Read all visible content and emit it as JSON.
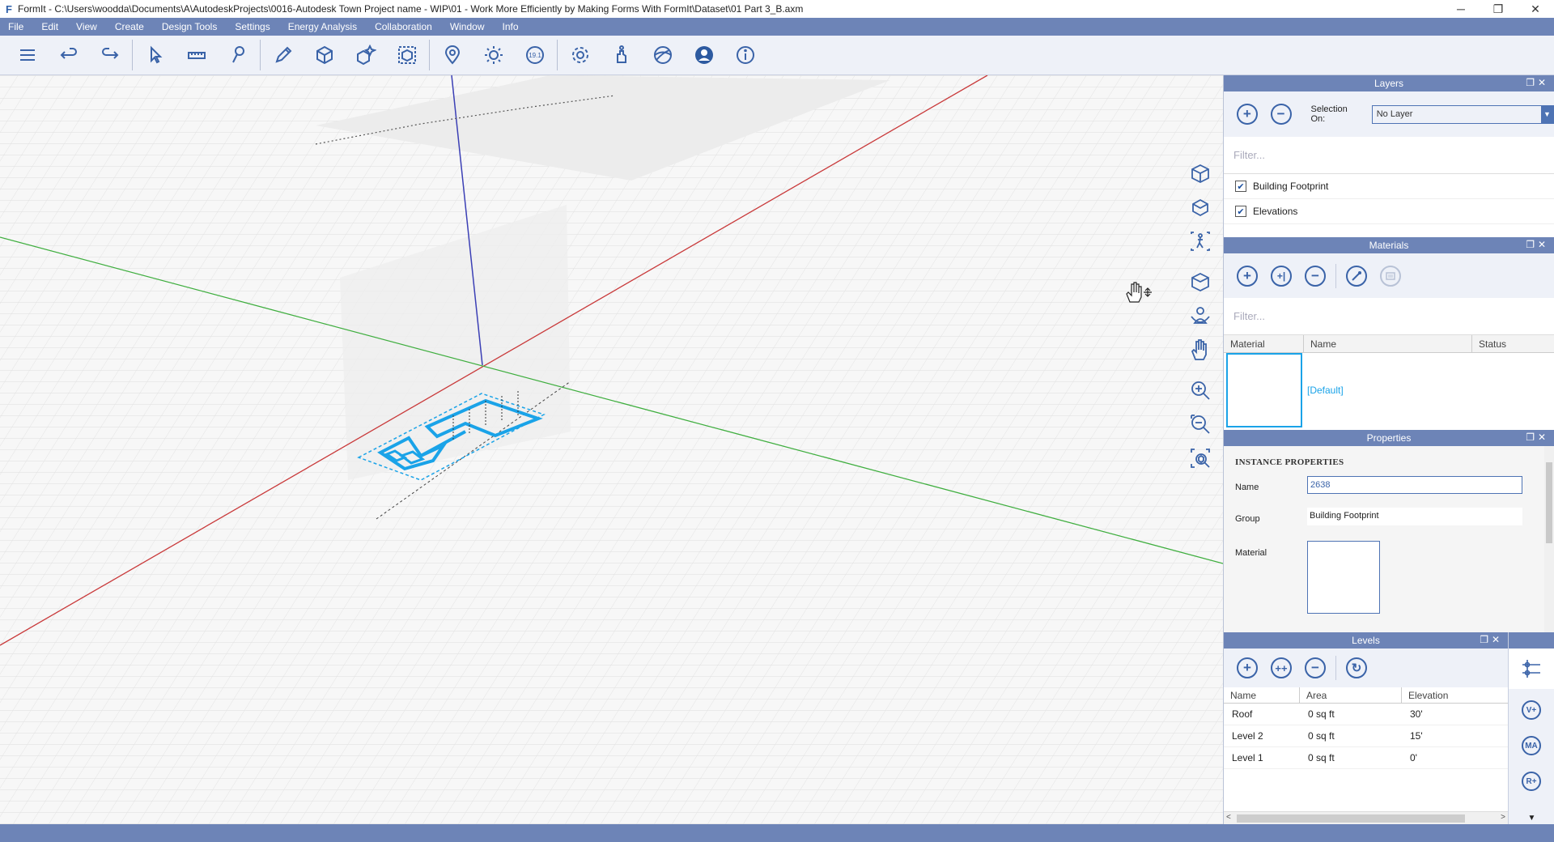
{
  "window": {
    "app_icon": "F",
    "title": "FormIt - C:\\Users\\woodda\\Documents\\A\\AutodeskProjects\\0016-Autodesk Town Project name - WIP\\01 - Work More Efficiently by Making Forms With FormIt\\Dataset\\01 Part 3_B.axm",
    "minimize": "─",
    "maximize": "❐",
    "close": "✕"
  },
  "menu": [
    "File",
    "Edit",
    "View",
    "Create",
    "Design Tools",
    "Settings",
    "Energy Analysis",
    "Collaboration",
    "Window",
    "Info"
  ],
  "toolbar": {
    "groups": [
      [
        "menu-icon",
        "undo-icon",
        "redo-icon"
      ],
      [
        "select-icon",
        "dimension-icon",
        "paint-icon"
      ],
      [
        "sketch-icon",
        "cube-icon",
        "component-icon",
        "group-icon"
      ],
      [
        "location-icon",
        "sun-icon",
        "scale-icon"
      ],
      [
        "gear-icon",
        "dynamo-icon",
        "globe-icon",
        "user-icon",
        "info-icon"
      ]
    ]
  },
  "navbar": [
    [
      "view-cube-icon",
      "orbit-box-icon",
      "walk-icon"
    ],
    [
      "perspective-icon",
      "look-around-icon",
      "pan-icon"
    ],
    [
      "zoom-in-icon",
      "zoom-out-icon",
      "zoom-extents-icon"
    ]
  ],
  "layers": {
    "title": "Layers",
    "selection_label": "Selection On:",
    "selection_value": "No Layer",
    "filter_placeholder": "Filter...",
    "items": [
      {
        "label": "Building Footprint",
        "checked": true
      },
      {
        "label": "Elevations",
        "checked": true
      }
    ]
  },
  "materials": {
    "title": "Materials",
    "filter_placeholder": "Filter...",
    "columns": [
      "Material",
      "Name",
      "Status"
    ],
    "rows": [
      {
        "name": "[Default]",
        "status": ""
      }
    ]
  },
  "properties": {
    "title": "Properties",
    "section": "INSTANCE PROPERTIES",
    "name_label": "Name",
    "name_value": "2638",
    "group_label": "Group",
    "group_value": "Building Footprint",
    "material_label": "Material"
  },
  "levels": {
    "title": "Levels",
    "columns": [
      "Name",
      "Area",
      "Elevation"
    ],
    "rows": [
      {
        "name": "Roof",
        "area": "0 sq ft",
        "elevation": "30'"
      },
      {
        "name": "Level 2",
        "area": "0 sq ft",
        "elevation": "15'"
      },
      {
        "name": "Level 1",
        "area": "0 sq ft",
        "elevation": "0'"
      }
    ],
    "side_buttons": [
      "V+",
      "MA",
      "R+"
    ]
  },
  "colors": {
    "accent": "#6d84b7",
    "selection": "#1aa3e8",
    "axis_x": "#c9393a",
    "axis_y": "#3fae3f",
    "axis_z": "#3b3fb5"
  }
}
